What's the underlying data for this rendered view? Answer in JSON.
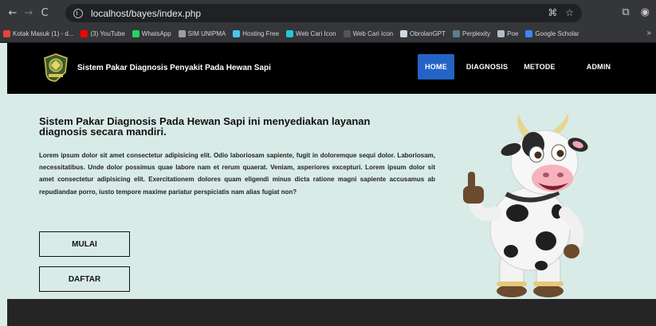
{
  "browser": {
    "url": "localhost/bayes/index.php",
    "nav": {
      "back": "←",
      "forward": "→",
      "reload": "C"
    },
    "bookmarks": [
      {
        "label": "Kotak Masuk (1) - d...",
        "icon_color": "#ea4335"
      },
      {
        "label": "(3) YouTube",
        "icon_color": "#ff0000"
      },
      {
        "label": "WhatsApp",
        "icon_color": "#25d366"
      },
      {
        "label": "SIM UNIPMA",
        "icon_color": "#9e9e9e"
      },
      {
        "label": "Hosting Free",
        "icon_color": "#4fc3f7"
      },
      {
        "label": "Web Cari Icon",
        "icon_color": "#26c6da"
      },
      {
        "label": "Web Cari Icon",
        "icon_color": "#555555"
      },
      {
        "label": "ObrolanGPT",
        "icon_color": "#cfd8dc"
      },
      {
        "label": "Perplexity",
        "icon_color": "#607d8b"
      },
      {
        "label": "Poe",
        "icon_color": "#b0bec5"
      },
      {
        "label": "Google Scholar",
        "icon_color": "#4285f4"
      }
    ],
    "more": "»"
  },
  "site": {
    "title": "Sistem Pakar Diagnosis Penyakit Pada Hewan Sapi",
    "menu": [
      {
        "label": "HOME",
        "active": true
      },
      {
        "label": "DIAGNOSIS",
        "active": false
      },
      {
        "label": "METODE",
        "active": false
      },
      {
        "label": "ADMIN",
        "active": false
      }
    ],
    "accent_color": "#2563c6"
  },
  "hero": {
    "headline": "Sistem Pakar Diagnosis Pada Hewan Sapi ini menyediakan layanan diagnosis secara mandiri.",
    "body": "Lorem ipsum dolor sit amet consectetur adipisicing elit. Odio laboriosam sapiente, fugit in doloremque sequi dolor. Laboriosam, necessitatibus. Unde dolor possimus quae labore nam et rerum quaerat. Veniam, asperiores excepturi. Lorem ipsum dolor sit amet consectetur adipisicing elit. Exercitationem dolores quam eligendi minus dicta ratione magni sapiente accusamus ab repudiandae porro, iusto tempore maxime pariatur perspiciatis nam alias fugiat non?",
    "buttons": {
      "start": "MULAI",
      "register": "DAFTAR"
    },
    "image": "cow-mascot"
  }
}
